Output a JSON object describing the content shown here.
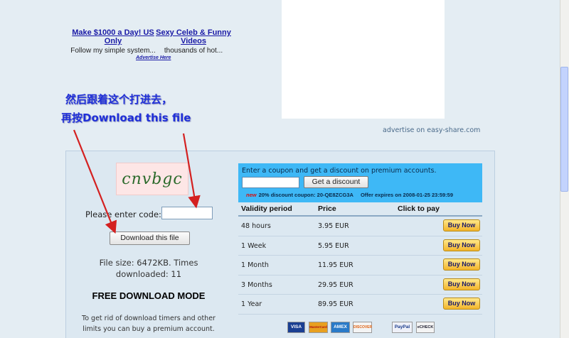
{
  "ads": [
    {
      "title": "Make $1000 a Day! US Only",
      "desc": "Follow my simple system..."
    },
    {
      "title": "Sexy Celeb & Funny Videos",
      "desc": "thousands of hot..."
    }
  ],
  "advertise_here": "Advertise Here",
  "advertise_link": "advertise on easy-share.com",
  "annotation": {
    "line1": "然后跟着这个打进去，",
    "line2": "再按Download this file"
  },
  "captcha_text": "cnvbgc",
  "code_label": "Please enter code:",
  "download_button": "Download this file",
  "file_size_line": "File size: 6472KB. Times",
  "downloaded_line": "downloaded: 11",
  "free_mode": "FREE DOWNLOAD MODE",
  "premium_note_1": "To get rid of download timers and other",
  "premium_note_2": "limits you can buy a premium account.",
  "coupon": {
    "text": "Enter a coupon and get a discount on premium accounts.",
    "button": "Get a discount",
    "new_label": "new",
    "discount": "20% discount coupon: 20-QE8ZCG3A",
    "expires": "Offer expires on 2008-01-25 23:59:59"
  },
  "price_table": {
    "headers": {
      "period": "Validity period",
      "price": "Price",
      "pay": "Click to pay"
    },
    "buy_label": "Buy Now",
    "rows": [
      {
        "period": "48 hours",
        "price": "3.95 EUR"
      },
      {
        "period": "1 Week",
        "price": "5.95 EUR"
      },
      {
        "period": "1 Month",
        "price": "11.95 EUR"
      },
      {
        "period": "3 Months",
        "price": "29.95 EUR"
      },
      {
        "period": "1 Year",
        "price": "89.95 EUR"
      }
    ]
  },
  "payment_logos": [
    "VISA",
    "MasterCard",
    "AMEX",
    "DISCOVER",
    "PayPal",
    "eCHECK"
  ],
  "colors": {
    "background": "#e4edf3",
    "coupon_bg": "#3eb8f6",
    "annotation": "#1f2fd8",
    "arrow": "#d42020",
    "buy_button": "#f3b42a"
  }
}
